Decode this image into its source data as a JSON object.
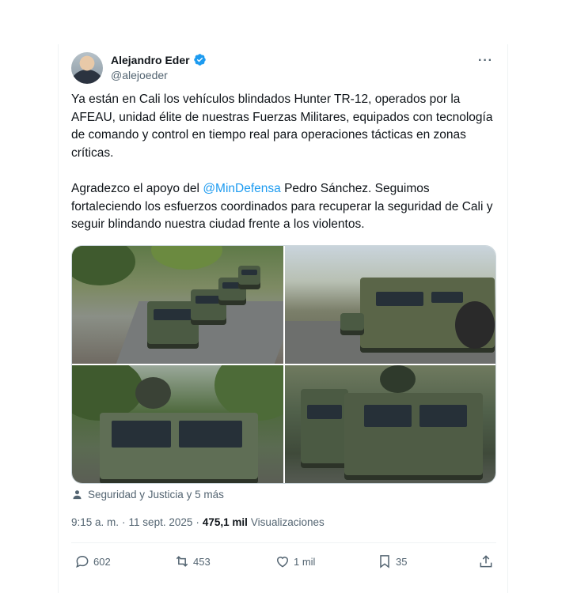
{
  "author": {
    "name": "Alejandro Eder",
    "handle": "@alejoeder",
    "verified": true
  },
  "more_label": "···",
  "tweet": {
    "paragraph1": "Ya están en Cali los vehículos blindados Hunter TR-12, operados por la AFEAU, unidad élite de nuestras Fuerzas Militares, equipados con tecnología de comando y control en tiempo real para operaciones tácticas en zonas críticas.",
    "paragraph2_before": "Agradezco el apoyo del ",
    "mention": "@MinDefensa",
    "paragraph2_after": " Pedro Sánchez. Seguimos fortaleciendo los esfuerzos coordinados para recuperar la seguridad de Cali y seguir blindando nuestra ciudad frente a los violentos."
  },
  "tagged": "Seguridad y Justicia y 5 más",
  "meta": {
    "time": "9:15 a. m.",
    "separator": "·",
    "date": "11 sept. 2025",
    "views_count": "475,1 mil",
    "views_label": "Visualizaciones"
  },
  "actions": {
    "replies": "602",
    "reposts": "453",
    "likes": "1 mil",
    "bookmarks": "35"
  },
  "colors": {
    "accent": "#1d9bf0",
    "secondary_text": "#536471",
    "primary_text": "#0f1419"
  }
}
